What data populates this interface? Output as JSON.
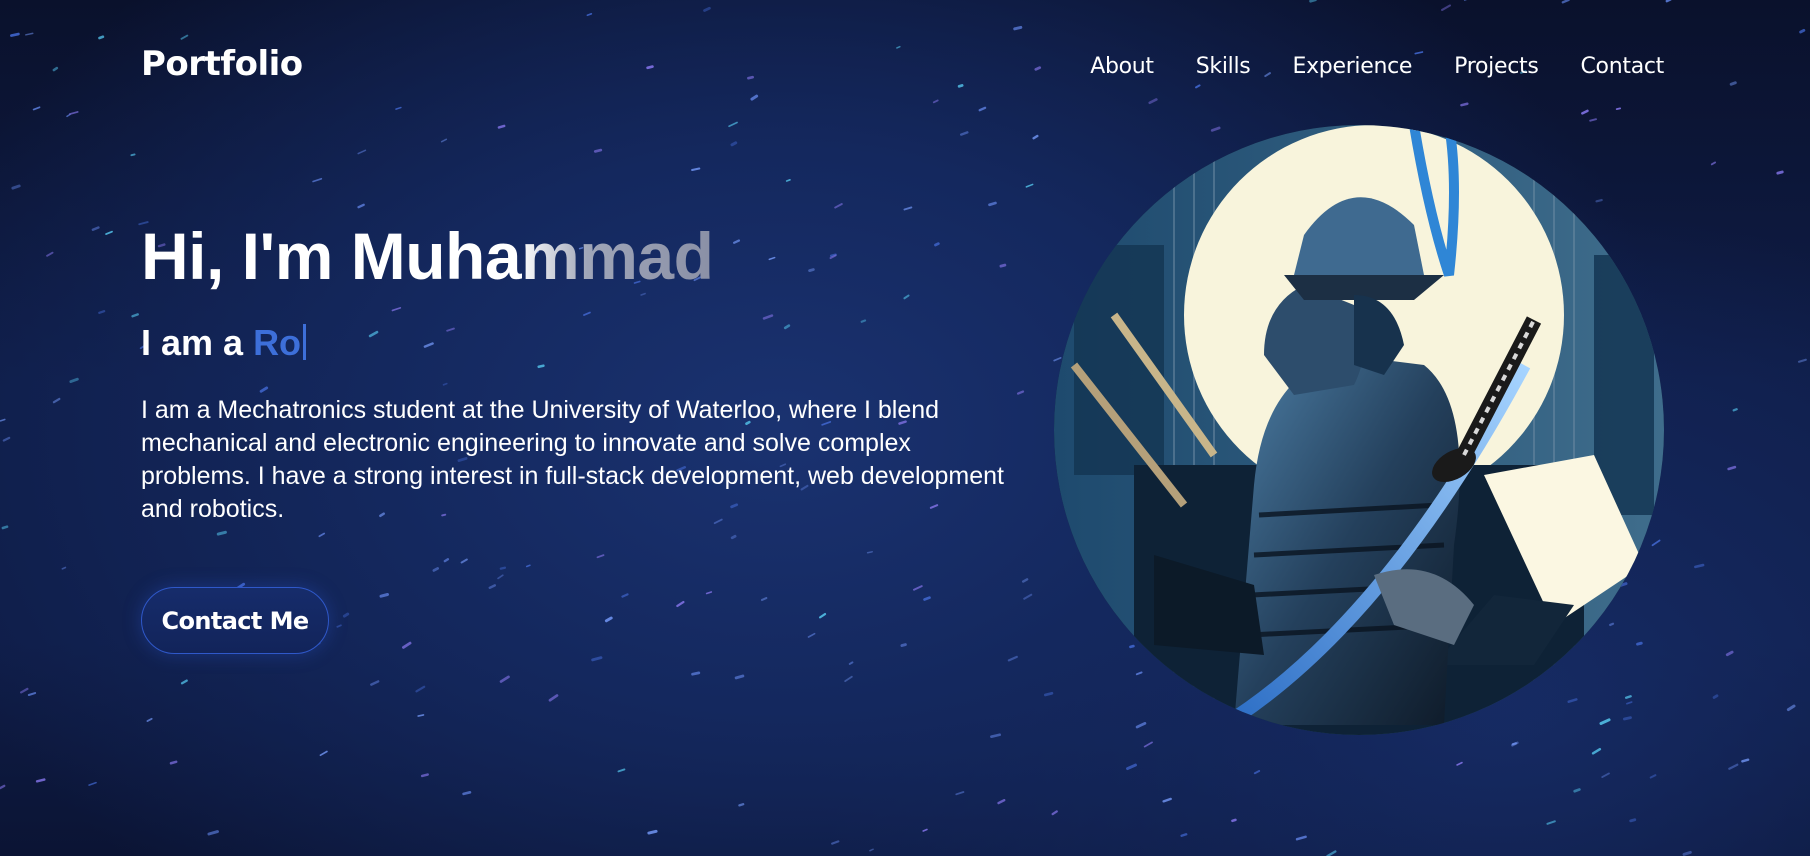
{
  "nav": {
    "brand": "Portfolio",
    "items": [
      {
        "label": "About"
      },
      {
        "label": "Skills"
      },
      {
        "label": "Experience"
      },
      {
        "label": "Projects"
      },
      {
        "label": "Contact"
      }
    ]
  },
  "hero": {
    "greeting": "Hi, I'm Muhammad",
    "role_prefix": "I am a",
    "role_typed": "Ro",
    "bio": "I am a Mechatronics student at the University of Waterloo, where I blend mechanical and electronic engineering to innovate and solve complex problems. I have a strong interest in full-stack development, web development and robotics.",
    "cta_label": "Contact Me"
  },
  "portrait": {
    "icon": "samurai-avatar-image"
  },
  "colors": {
    "accent": "#3d6fd9",
    "background": "#0f1d48",
    "button_border": "#2f58c9"
  }
}
